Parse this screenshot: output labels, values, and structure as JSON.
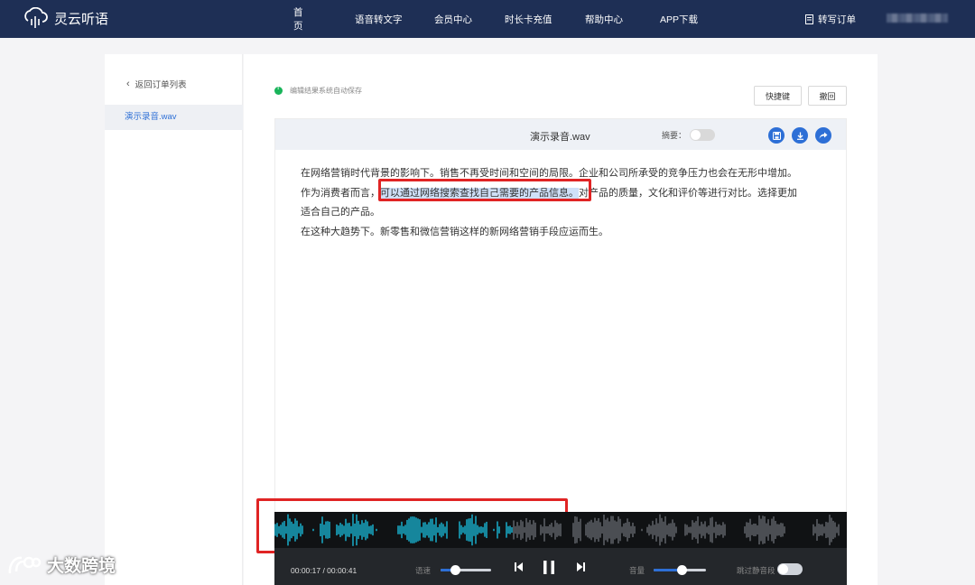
{
  "app": {
    "name": "灵云听语"
  },
  "nav": {
    "items": [
      "首页",
      "语音转文字",
      "会员中心",
      "时长卡充值",
      "帮助中心",
      "APP下载"
    ],
    "order_link": "转写订单"
  },
  "sidebar": {
    "back_label": "返回订单列表",
    "files": [
      "演示录音.wav"
    ]
  },
  "main": {
    "autosave_text": "编辑结果系统自动保存",
    "shortcut_button": "快捷键",
    "undo_button": "撤回",
    "file_title": "演示录音.wav",
    "summary_label": "摘要：",
    "text": {
      "line1": "在网络营销时代背景的影响下。销售不再受时间和空间的局限。企业和公司所承受的竞争压力也会在无形中增加。",
      "line2_a": "作为消费者而言，",
      "line2_highlight": "可以通过网络搜索查找自己需要的产品信息。",
      "line2_b": "对产品的质量，文化和评价等进行对比。选择更加",
      "line3": "适合自己的产品。",
      "line4": "在这种大趋势下。新零售和微信营销这样的新网络营销手段应运而生。"
    }
  },
  "player": {
    "time": "00:00:17 / 00:00:41",
    "speed_label": "语速",
    "volume_label": "音量",
    "skip_silence_label": "跳过静音段",
    "progress": 0.415,
    "speed_level": 0.3,
    "volume_level": 0.55,
    "played_color": "#19c6e6",
    "unplayed_color": "#6b6f75"
  },
  "watermark": {
    "text": "大数跨境"
  },
  "colors": {
    "nav_bg": "#1e2f55",
    "accent": "#2d6fd6",
    "highlight_box": "#e02424"
  }
}
